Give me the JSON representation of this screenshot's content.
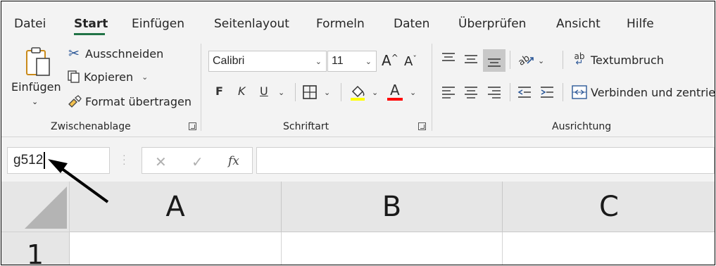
{
  "tabs": [
    "Datei",
    "Start",
    "Einfügen",
    "Seitenlayout",
    "Formeln",
    "Daten",
    "Überprüfen",
    "Ansicht",
    "Hilfe"
  ],
  "clipboard": {
    "paste_label": "Einfügen",
    "cut_label": "Ausschneiden",
    "copy_label": "Kopieren",
    "format_painter_label": "Format übertragen",
    "group_label": "Zwischenablage"
  },
  "font": {
    "font_name": "Calibri",
    "font_size": "11",
    "grow_label": "A",
    "shrink_label": "A",
    "bold_label": "F",
    "italic_label": "K",
    "underline_label": "U",
    "font_color_letter": "A",
    "group_label": "Schriftart",
    "highlight_color": "#ffff00",
    "font_color": "#ff0000"
  },
  "alignment": {
    "wrap_label": "Textumbruch",
    "merge_label": "Verbinden und zentriere",
    "group_label": "Ausrichtung",
    "wrap_icon_text": "ab"
  },
  "formula_bar": {
    "name_box_value": "g512",
    "cancel_symbol": "✕",
    "enter_symbol": "✓",
    "fx_symbol": "fx",
    "formula_value": ""
  },
  "sheet": {
    "columns": [
      "A",
      "B",
      "C"
    ],
    "rows": [
      "1"
    ]
  },
  "colors": {
    "accent": "#217346",
    "ribbon_bg": "#f3f3f3",
    "header_bg": "#e6e6e6"
  }
}
